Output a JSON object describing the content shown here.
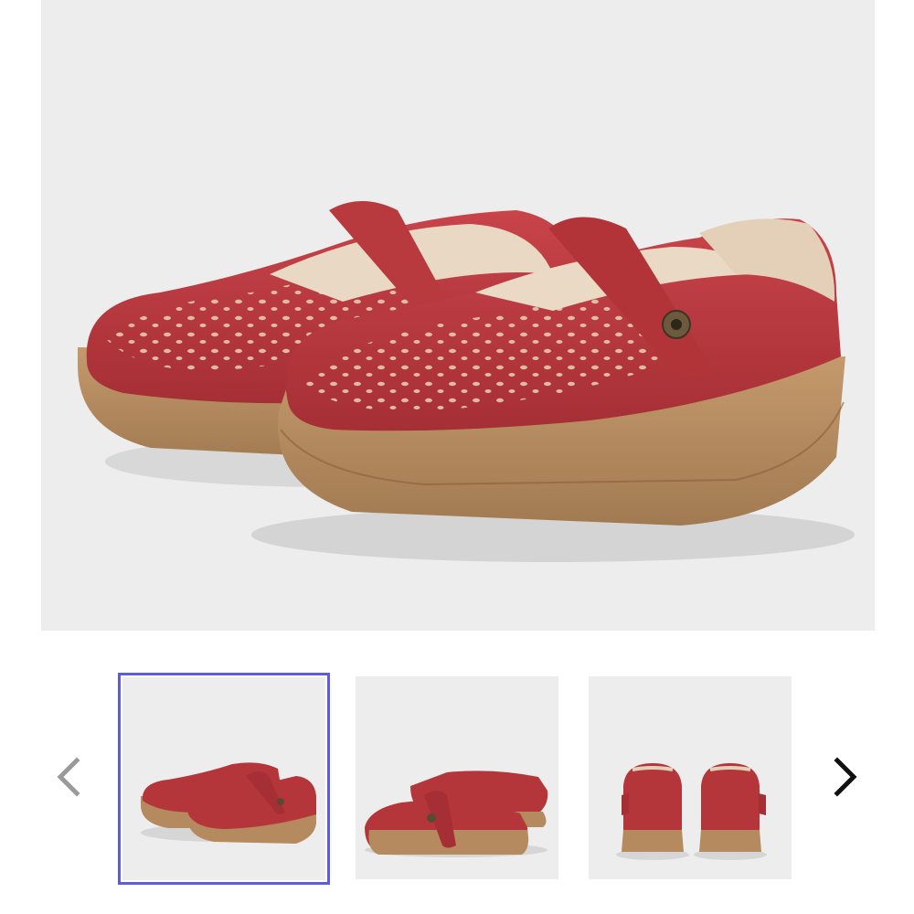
{
  "gallery": {
    "main_image": {
      "icon": "red-mary-jane-clog-pair-photo"
    },
    "prev_arrow": {
      "icon": "chevron-left-icon",
      "color": "#9a9a9a"
    },
    "next_arrow": {
      "icon": "chevron-right-icon",
      "color": "#111111"
    },
    "thumbnails": [
      {
        "icon": "shoe-pair-angled-view",
        "selected": true
      },
      {
        "icon": "shoe-pair-side-view",
        "selected": false
      },
      {
        "icon": "shoe-pair-back-view",
        "selected": false
      }
    ],
    "selected_border_color": "#5b5be8",
    "shoe_color": "#b5363a",
    "sole_color": "#b48a5e",
    "background_color": "#ededed"
  }
}
